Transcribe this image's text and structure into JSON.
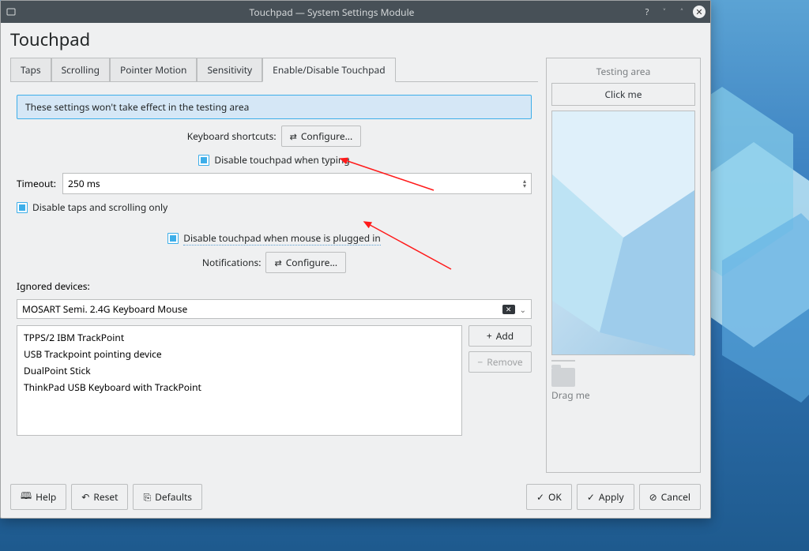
{
  "window": {
    "title": "Touchpad — System Settings Module",
    "heading": "Touchpad"
  },
  "tabs": [
    "Taps",
    "Scrolling",
    "Pointer Motion",
    "Sensitivity",
    "Enable/Disable Touchpad"
  ],
  "active_tab": 4,
  "info": "These settings won't take effect in the testing area",
  "kb_shortcuts_label": "Keyboard shortcuts:",
  "configure_btn": "Configure...",
  "disable_typing": "Disable touchpad when typing",
  "timeout_label": "Timeout:",
  "timeout_value": "250 ms",
  "disable_taps": "Disable taps and scrolling only",
  "disable_mouse": "Disable touchpad when mouse is plugged in",
  "notifications_label": "Notifications:",
  "ignored_label": "Ignored devices:",
  "ignored_value": "MOSART Semi. 2.4G Keyboard Mouse",
  "devices": [
    "TPPS/2 IBM TrackPoint",
    "USB Trackpoint pointing device",
    "DualPoint Stick",
    "ThinkPad USB Keyboard with TrackPoint"
  ],
  "add_btn": "Add",
  "remove_btn": "Remove",
  "testing": {
    "header": "Testing area",
    "click_me": "Click me",
    "drag_me": "Drag me"
  },
  "footer": {
    "help": "Help",
    "reset": "Reset",
    "defaults": "Defaults",
    "ok": "OK",
    "apply": "Apply",
    "cancel": "Cancel"
  }
}
